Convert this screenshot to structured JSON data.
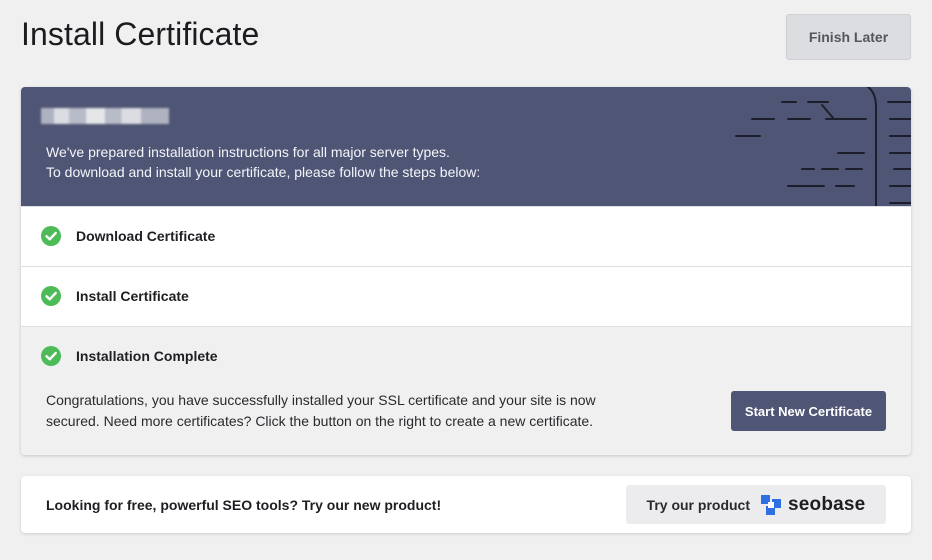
{
  "header": {
    "title": "Install Certificate",
    "finish_later_label": "Finish Later"
  },
  "banner": {
    "line1": "We've prepared installation instructions for all major server types.",
    "line2": "To download and install your certificate, please follow the steps below:"
  },
  "steps": [
    {
      "label": "Download Certificate",
      "status": "complete"
    },
    {
      "label": "Install Certificate",
      "status": "complete"
    },
    {
      "label": "Installation Complete",
      "status": "complete"
    }
  ],
  "completion": {
    "message": "Congratulations, you have successfully installed your SSL certificate and your site is now secured. Need more certificates? Click the button on the right to create a new certificate.",
    "start_new_label": "Start New Certificate"
  },
  "promo": {
    "text": "Looking for free, powerful SEO tools? Try our new product!",
    "button_label": "Try our product",
    "brand_name": "seobase",
    "brand_icon": "seobase-logo-icon"
  },
  "colors": {
    "banner_bg": "#4f5675",
    "check_green": "#4cbb58",
    "primary_button": "#4f5675",
    "brand_blue": "#2f6fe4"
  }
}
